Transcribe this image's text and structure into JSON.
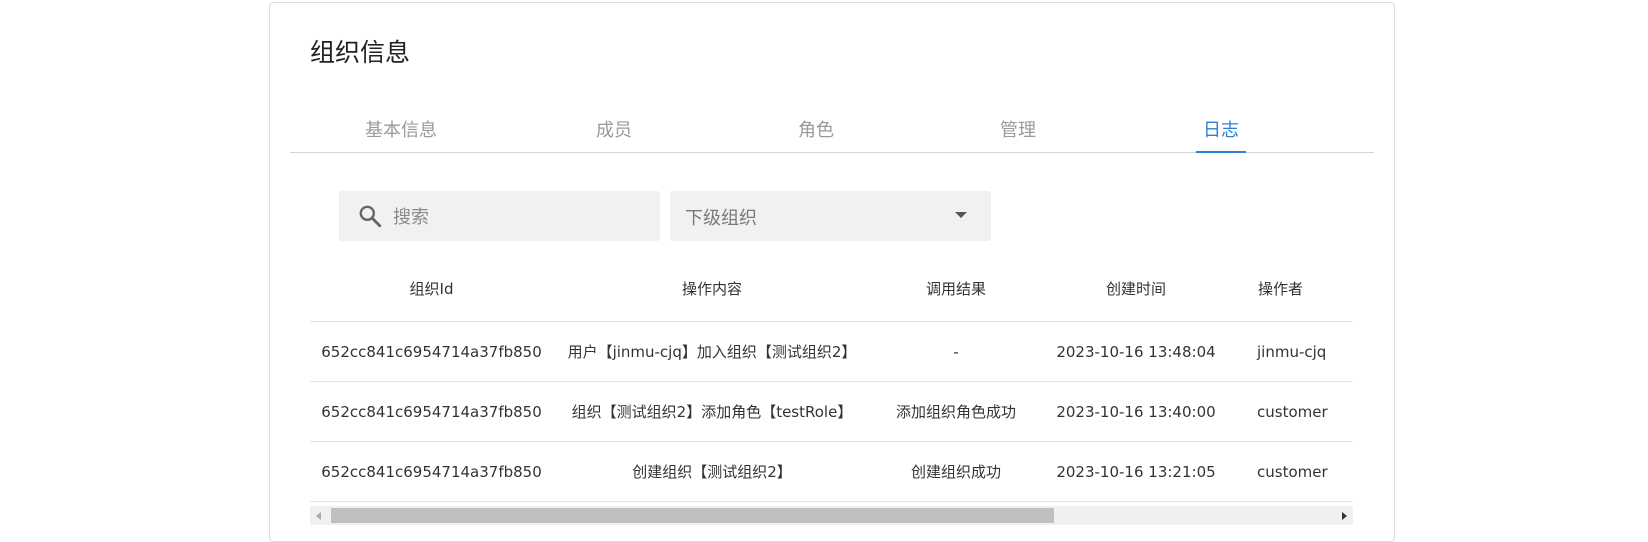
{
  "page": {
    "title": "组织信息"
  },
  "tabs": [
    {
      "label": "基本信息",
      "active": false
    },
    {
      "label": "成员",
      "active": false
    },
    {
      "label": "角色",
      "active": false
    },
    {
      "label": "管理",
      "active": false
    },
    {
      "label": "日志",
      "active": true
    }
  ],
  "filters": {
    "search_placeholder": "搜索",
    "search_value": "",
    "suborg_select_value": "下级组织"
  },
  "table": {
    "columns": [
      "组织Id",
      "操作内容",
      "调用结果",
      "创建时间",
      "操作者"
    ],
    "rows": [
      [
        "652cc841c6954714a37fb850",
        "用户【jinmu-cjq】加入组织【测试组织2】",
        "-",
        "2023-10-16 13:48:04",
        "jinmu-cjq"
      ],
      [
        "652cc841c6954714a37fb850",
        "组织【测试组织2】添加角色【testRole】",
        "添加组织角色成功",
        "2023-10-16 13:40:00",
        "customer"
      ],
      [
        "652cc841c6954714a37fb850",
        "创建组织【测试组织2】",
        "创建组织成功",
        "2023-10-16 13:21:05",
        "customer"
      ]
    ]
  },
  "colors": {
    "accent": "#2f80d3",
    "tab_inactive": "#9a9a9a",
    "input_bg": "#f1f1f1"
  },
  "icons": {
    "search": "search-icon",
    "dropdown": "caret-down-icon",
    "scroll_left": "scroll-left-arrow-icon",
    "scroll_right": "scroll-right-arrow-icon"
  }
}
